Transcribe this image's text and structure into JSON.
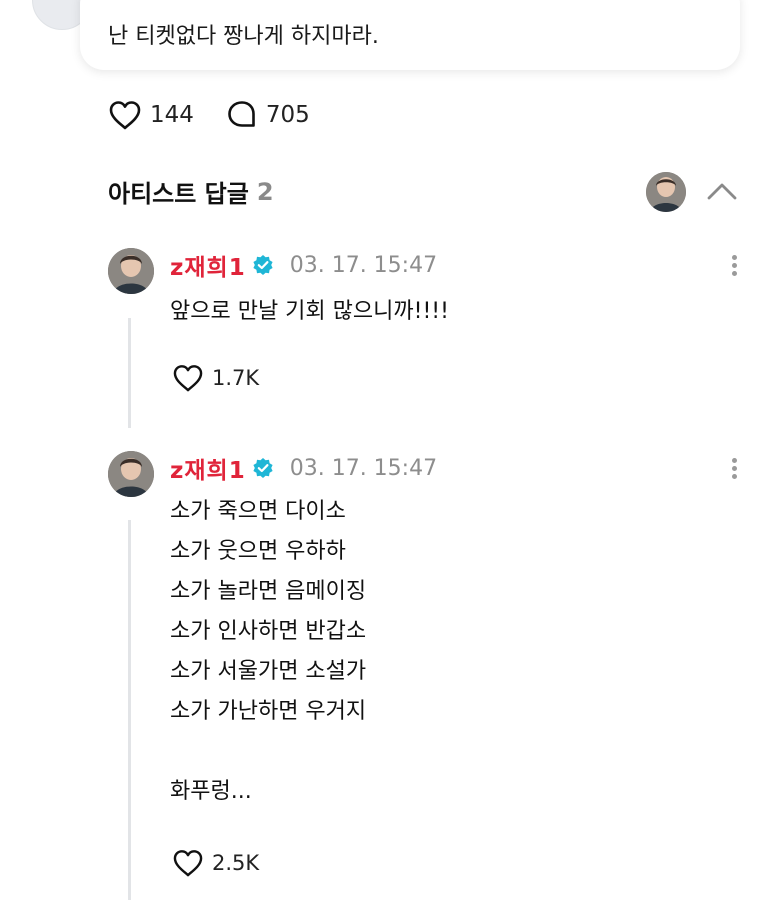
{
  "top_comment": {
    "text": "난 티켓없다 짱나게 하지마라."
  },
  "actions": {
    "likes": "144",
    "comments": "705"
  },
  "artist_replies": {
    "title": "아티스트 답글",
    "count": "2"
  },
  "replies": [
    {
      "author": "z재희1",
      "timestamp": "03. 17. 15:47",
      "text": "앞으로 만날 기회 많으니까!!!!",
      "likes": "1.7K"
    },
    {
      "author": "z재희1",
      "timestamp": "03. 17. 15:47",
      "text": "소가 죽으면 다이소\n소가 웃으면 우하하\n소가 놀라면 음메이징\n소가 인사하면 반갑소\n소가 서울가면 소설가\n소가 가난하면 우거지\n\n화푸렁...",
      "likes": "2.5K"
    }
  ],
  "colors": {
    "author": "#e0243a",
    "verified": "#1fb6d6",
    "muted": "#8d8d8d"
  }
}
